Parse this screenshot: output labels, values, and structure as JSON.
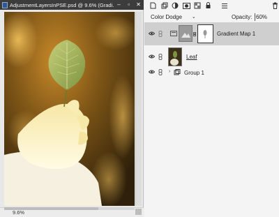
{
  "window": {
    "title": "AdjustmentLayersInPSE.psd @ 9.6% (Gradi...",
    "minimize_label": "–",
    "restore_label": "▫",
    "close_label": "✕"
  },
  "status": {
    "zoom": "9.6%"
  },
  "layers_panel": {
    "blend_mode": "Color Dodge",
    "opacity_label": "Opacity:",
    "opacity_value": "60%",
    "layers": [
      {
        "name": "Gradient Map 1",
        "selected": true
      },
      {
        "name": "Leaf",
        "selected": false
      },
      {
        "name": "Group 1",
        "selected": false
      }
    ]
  },
  "icons": {
    "new-layer": "new-layer-icon",
    "fill-adjustment": "fill-adjustment-icon",
    "mask": "layer-mask-icon",
    "lock-transparency": "lock-transparency-icon",
    "lock": "lock-icon",
    "delete": "trash-icon"
  },
  "colors": {
    "selected_row": "#cfcfcf",
    "titlebar": "#3c3c3c"
  }
}
